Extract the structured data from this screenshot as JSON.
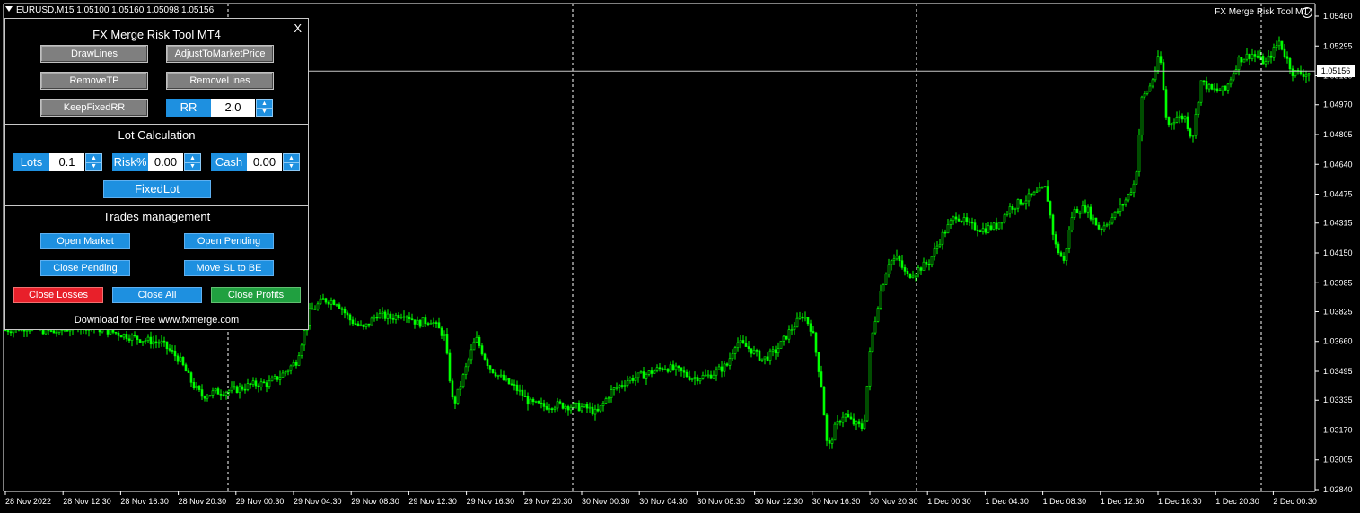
{
  "chart_header": "EURUSD,M15  1.05100 1.05160 1.05098 1.05156",
  "indicator_name": "FX Merge Risk Tool MT4",
  "current_price_label": "1.05156",
  "colors": {
    "background": "#000000",
    "candles": "#00ff00",
    "grid": "#ffffff",
    "axis": "#ffffff"
  },
  "panel": {
    "title": "FX Merge Risk Tool MT4",
    "close_label": "X",
    "buttons": {
      "draw_lines": "DrawLines",
      "adjust": "AdjustToMarketPrice",
      "remove_tp": "RemoveTP",
      "remove_lines": "RemoveLines",
      "keep_fixed_rr": "KeepFixedRR"
    },
    "rr": {
      "label": "RR",
      "value": "2.0"
    },
    "lot_calc": {
      "title": "Lot Calculation",
      "lots_label": "Lots",
      "lots_value": "0.1",
      "risk_label": "Risk%",
      "risk_value": "0.00",
      "cash_label": "Cash",
      "cash_value": "0.00",
      "fixed_lot": "FixedLot"
    },
    "trades": {
      "title": "Trades management",
      "open_market": "Open Market",
      "open_pending": "Open Pending",
      "close_pending": "Close Pending",
      "move_sl_be": "Move SL to BE",
      "close_losses": "Close Losses",
      "close_all": "Close All",
      "close_profits": "Close Profits"
    },
    "footer": "Download for Free www.fxmerge.com"
  },
  "chart_data": {
    "type": "candlestick",
    "symbol": "EURUSD",
    "timeframe": "M15",
    "ylim": [
      1.0284,
      1.0546
    ],
    "y_ticks": [
      "1.05460",
      "1.05295",
      "1.05130",
      "1.04970",
      "1.04805",
      "1.04640",
      "1.04475",
      "1.04315",
      "1.04150",
      "1.03985",
      "1.03825",
      "1.03660",
      "1.03495",
      "1.03335",
      "1.03170",
      "1.03005",
      "1.02840"
    ],
    "x_ticks": [
      "28 Nov 2022",
      "28 Nov 12:30",
      "28 Nov 16:30",
      "28 Nov 20:30",
      "29 Nov 00:30",
      "29 Nov 04:30",
      "29 Nov 08:30",
      "29 Nov 12:30",
      "29 Nov 16:30",
      "29 Nov 20:30",
      "30 Nov 00:30",
      "30 Nov 04:30",
      "30 Nov 08:30",
      "30 Nov 12:30",
      "30 Nov 16:30",
      "30 Nov 20:30",
      "1 Dec 00:30",
      "1 Dec 04:30",
      "1 Dec 08:30",
      "1 Dec 12:30",
      "1 Dec 16:30",
      "1 Dec 20:30",
      "2 Dec 00:30"
    ],
    "close_path": [
      [
        0,
        1.0372
      ],
      [
        30,
        1.0374
      ],
      [
        60,
        1.0371
      ],
      [
        90,
        1.0375
      ],
      [
        120,
        1.0372
      ],
      [
        150,
        1.0368
      ],
      [
        180,
        1.0365
      ],
      [
        200,
        1.0356
      ],
      [
        215,
        1.0342
      ],
      [
        225,
        1.0336
      ],
      [
        240,
        1.0338
      ],
      [
        260,
        1.0339
      ],
      [
        280,
        1.0342
      ],
      [
        300,
        1.0343
      ],
      [
        315,
        1.0348
      ],
      [
        330,
        1.0355
      ],
      [
        345,
        1.0382
      ],
      [
        360,
        1.0389
      ],
      [
        375,
        1.0388
      ],
      [
        390,
        1.0378
      ],
      [
        405,
        1.0373
      ],
      [
        420,
        1.0381
      ],
      [
        435,
        1.0379
      ],
      [
        450,
        1.0382
      ],
      [
        465,
        1.0376
      ],
      [
        480,
        1.0378
      ],
      [
        495,
        1.0369
      ],
      [
        505,
        1.033
      ],
      [
        515,
        1.0345
      ],
      [
        530,
        1.0368
      ],
      [
        545,
        1.0352
      ],
      [
        560,
        1.0345
      ],
      [
        575,
        1.034
      ],
      [
        590,
        1.0332
      ],
      [
        605,
        1.033
      ],
      [
        620,
        1.0331
      ],
      [
        640,
        1.033
      ],
      [
        655,
        1.0329
      ],
      [
        665,
        1.0326
      ],
      [
        680,
        1.0338
      ],
      [
        700,
        1.0345
      ],
      [
        720,
        1.0348
      ],
      [
        740,
        1.0352
      ],
      [
        755,
        1.035
      ],
      [
        770,
        1.0346
      ],
      [
        790,
        1.0347
      ],
      [
        810,
        1.0353
      ],
      [
        820,
        1.0366
      ],
      [
        835,
        1.0362
      ],
      [
        850,
        1.0356
      ],
      [
        865,
        1.0361
      ],
      [
        880,
        1.0372
      ],
      [
        895,
        1.0381
      ],
      [
        905,
        1.0372
      ],
      [
        915,
        1.0342
      ],
      [
        922,
        1.0305
      ],
      [
        930,
        1.0318
      ],
      [
        940,
        1.0326
      ],
      [
        950,
        1.0321
      ],
      [
        962,
        1.0318
      ],
      [
        970,
        1.0365
      ],
      [
        980,
        1.0392
      ],
      [
        990,
        1.041
      ],
      [
        1000,
        1.0412
      ],
      [
        1010,
        1.0402
      ],
      [
        1020,
        1.0405
      ],
      [
        1035,
        1.041
      ],
      [
        1050,
        1.0425
      ],
      [
        1065,
        1.0436
      ],
      [
        1080,
        1.043
      ],
      [
        1095,
        1.0428
      ],
      [
        1110,
        1.043
      ],
      [
        1125,
        1.044
      ],
      [
        1140,
        1.0444
      ],
      [
        1155,
        1.0448
      ],
      [
        1165,
        1.0451
      ],
      [
        1175,
        1.042
      ],
      [
        1185,
        1.041
      ],
      [
        1195,
        1.0438
      ],
      [
        1210,
        1.044
      ],
      [
        1225,
        1.0428
      ],
      [
        1240,
        1.0435
      ],
      [
        1255,
        1.0445
      ],
      [
        1265,
        1.0455
      ],
      [
        1272,
        1.05
      ],
      [
        1282,
        1.0508
      ],
      [
        1292,
        1.0525
      ],
      [
        1300,
        1.0485
      ],
      [
        1310,
        1.049
      ],
      [
        1320,
        1.049
      ],
      [
        1328,
        1.0478
      ],
      [
        1338,
        1.051
      ],
      [
        1350,
        1.0505
      ],
      [
        1365,
        1.0505
      ],
      [
        1380,
        1.0522
      ],
      [
        1395,
        1.0525
      ],
      [
        1410,
        1.052
      ],
      [
        1425,
        1.0532
      ],
      [
        1440,
        1.0515
      ],
      [
        1455,
        1.0514
      ],
      [
        1460,
        1.0515
      ]
    ]
  }
}
